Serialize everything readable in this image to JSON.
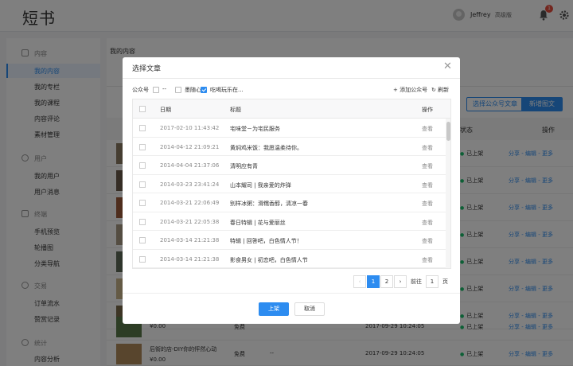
{
  "header": {
    "logo": "短书",
    "user_name": "Jeffrey",
    "plan": "高级版",
    "notification_count": "1"
  },
  "sidebar": {
    "groups": [
      {
        "label": "内容",
        "items": [
          "我的内容",
          "我的专栏",
          "我的课程",
          "内容评论",
          "素材管理"
        ]
      },
      {
        "label": "用户",
        "items": [
          "我的用户",
          "用户消息"
        ]
      },
      {
        "label": "终端",
        "items": [
          "手机预览",
          "轮播图",
          "分类导航"
        ]
      },
      {
        "label": "交易",
        "items": [
          "订单流水",
          "赞赏记录"
        ]
      },
      {
        "label": "统计",
        "items": [
          "内容分析"
        ]
      }
    ],
    "active_item": "我的内容"
  },
  "main": {
    "breadcrumb": "我的内容",
    "select_button": "选择公众号文章",
    "new_button": "新增图文",
    "header_status": "状态",
    "header_ops": "操作",
    "rows": [
      {
        "status": "已上架",
        "ops": "分享 - 编辑 - 更多"
      },
      {
        "status": "已上架",
        "ops": "分享 - 编辑 - 更多"
      },
      {
        "status": "已上架",
        "ops": "分享 - 编辑 - 更多"
      },
      {
        "status": "已上架",
        "ops": "分享 - 编辑 - 更多"
      },
      {
        "status": "已上架",
        "ops": "分享 - 编辑 - 更多"
      },
      {
        "status": "已上架",
        "ops": "分享 - 编辑 - 更多"
      },
      {
        "status": "已上架",
        "ops": "分享 - 编辑 - 更多"
      },
      {
        "status": "已上架",
        "ops": "分享 - 编辑 - 更多",
        "price": "¥0.00",
        "fee": "免费",
        "date": "2017-09-29 10:24:05"
      },
      {
        "status": "已上架",
        "ops": "分享 - 编辑 - 更多",
        "title": "后街的店-DIY你的怦然心动",
        "price": "¥0.00",
        "fee": "免费",
        "dash": "--",
        "date": "2017-09-29 10:24:05"
      }
    ]
  },
  "modal": {
    "title": "选择文章",
    "filter_label": "公众号",
    "accounts": [
      {
        "name": "--",
        "checked": false
      },
      {
        "name": "墨随心",
        "checked": false
      },
      {
        "name": "吃喝玩乐在...",
        "checked": true
      }
    ],
    "add_account": "+ 添加公众号",
    "refresh": "刷新",
    "columns": {
      "date": "日期",
      "title": "标题",
      "action": "操作"
    },
    "articles": [
      {
        "date": "2017-02-10 11:43:42",
        "title": "宅味堂－为宅民服务",
        "action": "查看"
      },
      {
        "date": "2014-04-12 21:09:21",
        "title": "黄焖鸡米饭：我愿温柔待你。",
        "action": "查看"
      },
      {
        "date": "2014-04-04 21:37:06",
        "title": "清明应有青",
        "action": "查看"
      },
      {
        "date": "2014-03-23 23:41:24",
        "title": "山本耀司 | 我亲爱的炸弹",
        "action": "查看"
      },
      {
        "date": "2014-03-21 22:06:49",
        "title": "别样冰粥：滑糯香醇，清凉一春",
        "action": "查看"
      },
      {
        "date": "2014-03-21 22:05:38",
        "title": "春日特辑 | 花与爱丽丝",
        "action": "查看"
      },
      {
        "date": "2014-03-14 21:21:38",
        "title": "特辑 | 回答吧，白色情人节！",
        "action": "查看"
      },
      {
        "date": "2014-03-14 21:21:38",
        "title": "影食男女 | 初恋吧，白色情人节",
        "action": "查看"
      }
    ],
    "pager": {
      "prev": "‹",
      "pages": [
        "1",
        "2"
      ],
      "current": "1",
      "next": "›",
      "goto_label": "前往",
      "goto_value": "1",
      "page_suffix": "页"
    },
    "ok_button": "上架",
    "cancel_button": "取消"
  }
}
